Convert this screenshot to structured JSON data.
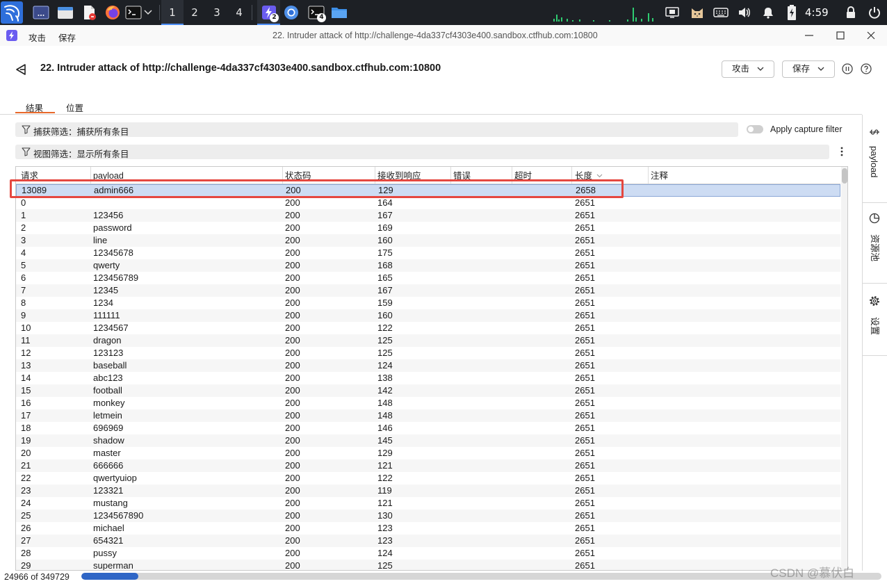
{
  "taskbar": {
    "launcher_icons": [
      "kali-menu-icon",
      "show-desktop-icon",
      "file-manager-icon",
      "text-editor-icon",
      "firefox-icon",
      "terminal-icon"
    ],
    "workspaces": [
      "1",
      "2",
      "3",
      "4"
    ],
    "active_workspace_index": 0,
    "tasks": [
      {
        "icon": "burp-suite-icon",
        "badge": "2",
        "active": true
      },
      {
        "icon": "chromium-icon"
      },
      {
        "icon": "terminal-icon",
        "badge": "4"
      },
      {
        "icon": "folder-icon"
      }
    ],
    "tray_icons": [
      "network-monitor-icon",
      "display-icon",
      "cat-icon",
      "keyboard-icon",
      "volume-icon",
      "notification-bell-icon",
      "battery-charging-icon",
      "lock-icon",
      "power-icon"
    ],
    "clock": "4:59"
  },
  "window": {
    "title": "22. Intruder attack of http://challenge-4da337cf4303e400.sandbox.ctfhub.com:10800",
    "menu": [
      "攻击",
      "保存"
    ],
    "controls": [
      "minimize-icon",
      "maximize-icon",
      "close-icon"
    ]
  },
  "header": {
    "title": "22. Intruder attack of http://challenge-4da337cf4303e400.sandbox.ctfhub.com:10800",
    "attack_button": "攻击",
    "save_button": "保存"
  },
  "tabs": [
    {
      "label": "结果",
      "active": true
    },
    {
      "label": "位置",
      "active": false
    }
  ],
  "capture_filter": {
    "label": "捕获筛选：捕获所有条目",
    "toggle_label": "Apply capture filter",
    "toggle_on": false
  },
  "view_filter": {
    "label": "视图筛选：显示所有条目"
  },
  "table": {
    "columns": [
      "请求",
      "payload",
      "状态码",
      "接收到响应",
      "错误",
      "超时",
      "长度",
      "注释"
    ],
    "sorted_column_index": 6,
    "selected_row_index": 0,
    "rows": [
      [
        "13089",
        "admin666",
        "200",
        "129",
        "2658"
      ],
      [
        "0",
        "",
        "200",
        "164",
        "2651"
      ],
      [
        "1",
        "123456",
        "200",
        "167",
        "2651"
      ],
      [
        "2",
        "password",
        "200",
        "169",
        "2651"
      ],
      [
        "3",
        "line",
        "200",
        "160",
        "2651"
      ],
      [
        "4",
        "12345678",
        "200",
        "175",
        "2651"
      ],
      [
        "5",
        "qwerty",
        "200",
        "168",
        "2651"
      ],
      [
        "6",
        "123456789",
        "200",
        "165",
        "2651"
      ],
      [
        "7",
        "12345",
        "200",
        "167",
        "2651"
      ],
      [
        "8",
        "1234",
        "200",
        "159",
        "2651"
      ],
      [
        "9",
        "111111",
        "200",
        "160",
        "2651"
      ],
      [
        "10",
        "1234567",
        "200",
        "122",
        "2651"
      ],
      [
        "11",
        "dragon",
        "200",
        "125",
        "2651"
      ],
      [
        "12",
        "123123",
        "200",
        "125",
        "2651"
      ],
      [
        "13",
        "baseball",
        "200",
        "124",
        "2651"
      ],
      [
        "14",
        "abc123",
        "200",
        "138",
        "2651"
      ],
      [
        "15",
        "football",
        "200",
        "142",
        "2651"
      ],
      [
        "16",
        "monkey",
        "200",
        "148",
        "2651"
      ],
      [
        "17",
        "letmein",
        "200",
        "148",
        "2651"
      ],
      [
        "18",
        "696969",
        "200",
        "146",
        "2651"
      ],
      [
        "19",
        "shadow",
        "200",
        "145",
        "2651"
      ],
      [
        "20",
        "master",
        "200",
        "129",
        "2651"
      ],
      [
        "21",
        "666666",
        "200",
        "121",
        "2651"
      ],
      [
        "22",
        "qwertyuiop",
        "200",
        "122",
        "2651"
      ],
      [
        "23",
        "123321",
        "200",
        "119",
        "2651"
      ],
      [
        "24",
        "mustang",
        "200",
        "121",
        "2651"
      ],
      [
        "25",
        "1234567890",
        "200",
        "130",
        "2651"
      ],
      [
        "26",
        "michael",
        "200",
        "123",
        "2651"
      ],
      [
        "27",
        "654321",
        "200",
        "123",
        "2651"
      ],
      [
        "28",
        "pussy",
        "200",
        "124",
        "2651"
      ],
      [
        "29",
        "superman",
        "200",
        "125",
        "2651"
      ]
    ]
  },
  "side_tabs": [
    {
      "label": "payload",
      "icon": "dollar-icon"
    },
    {
      "label": "资源池",
      "icon": "pie-chart-icon"
    },
    {
      "label": "设置",
      "icon": "gear-icon"
    }
  ],
  "status": {
    "progress_text": "24966 of 349729",
    "progress": 0.0714
  },
  "colors": {
    "taskbar": "#1d2025",
    "tab_accent": "#e8692b",
    "row_selection": "#cddcf3",
    "highlight_box": "#e5473f",
    "progress_fill": "#2f66c6"
  },
  "watermark": "CSDN @慕伏白"
}
